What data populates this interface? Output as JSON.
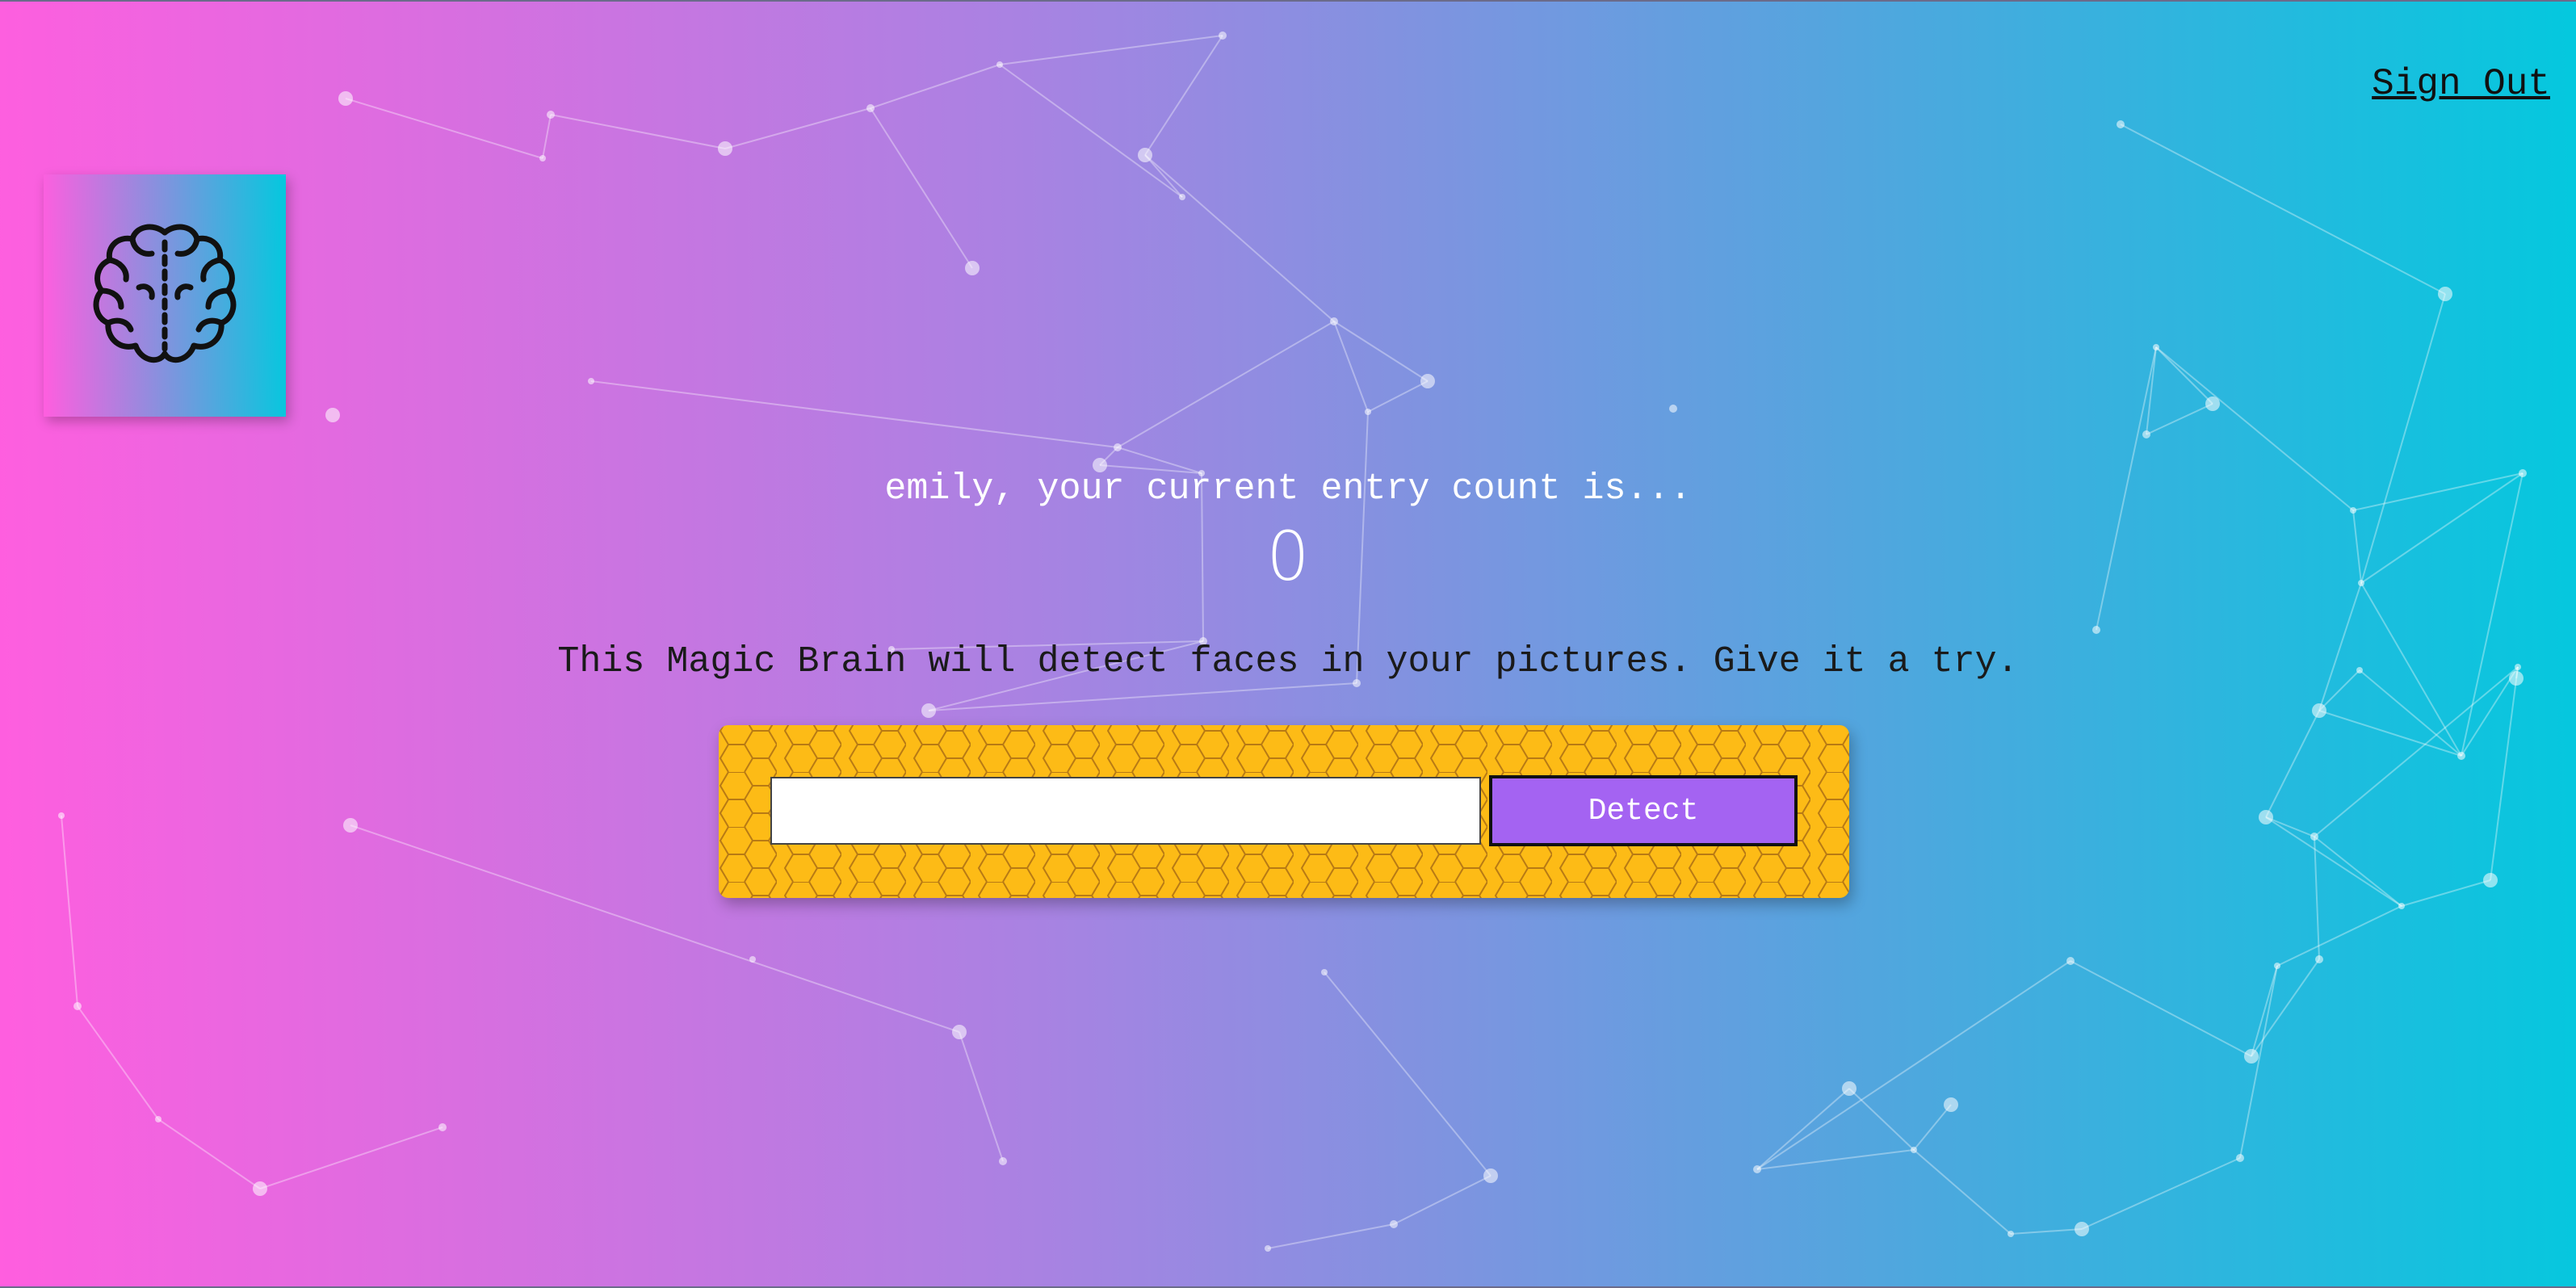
{
  "nav": {
    "signout_label": "Sign Out"
  },
  "logo": {
    "icon": "brain-icon"
  },
  "rank": {
    "message": "emily, your current entry count is...",
    "count": "0"
  },
  "image_form": {
    "tagline": "This Magic Brain will detect faces in your pictures. Give it a try.",
    "input_value": "",
    "input_placeholder": "",
    "detect_label": "Detect"
  },
  "colors": {
    "gradient_start": "#ff5edf",
    "gradient_end": "#04c8de",
    "form_background": "#fdbb16",
    "button_background": "#a463f2"
  }
}
